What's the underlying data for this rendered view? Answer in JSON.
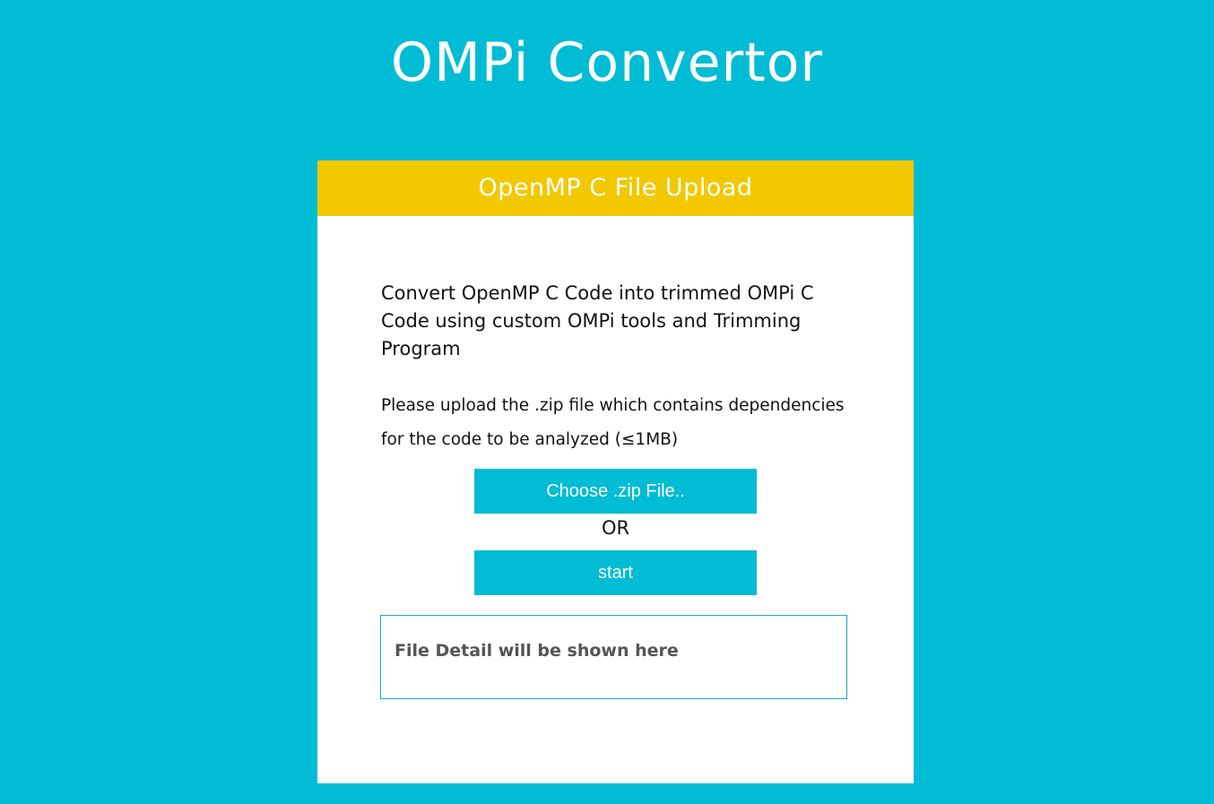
{
  "page": {
    "title": "OMPi Convertor"
  },
  "card": {
    "header": "OpenMP C File Upload",
    "intro": "Convert OpenMP C Code into trimmed OMPi C Code using custom OMPi tools and Trimming Program",
    "upload_note": "Please upload the .zip file which contains dependencies for the code to be analyzed (≤1MB)",
    "choose_button": "Choose .zip File..",
    "or_label": "OR",
    "start_button": "start",
    "file_detail": "File Detail will be shown here"
  },
  "colors": {
    "background": "#00bcd4",
    "header": "#f2c800",
    "button": "#00bcd4",
    "card": "#ffffff"
  }
}
